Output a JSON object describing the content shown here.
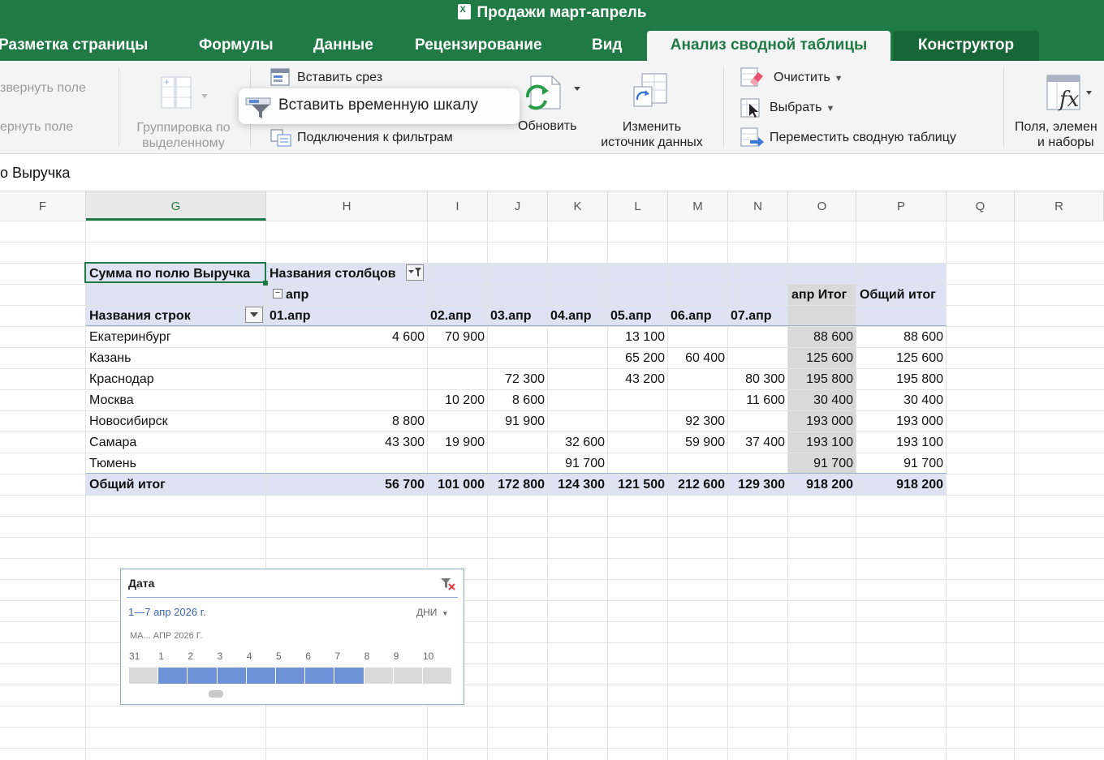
{
  "window": {
    "title": "Продажи март-апрель"
  },
  "tabs": [
    {
      "label": "Разметка страницы"
    },
    {
      "label": "Формулы"
    },
    {
      "label": "Данные"
    },
    {
      "label": "Рецензирование"
    },
    {
      "label": "Вид"
    },
    {
      "label": "Анализ сводной таблицы"
    },
    {
      "label": "Конструктор"
    }
  ],
  "ribbon": {
    "expand_field": "звернуть поле",
    "collapse_field": "ернуть поле",
    "group_line1": "Группировка по",
    "group_line2": "выделенному",
    "insert_slicer": "Вставить срез",
    "insert_timeline": "Вставить временную шкалу",
    "filter_connections": "Подключения к фильтрам",
    "refresh": "Обновить",
    "change_source_line1": "Изменить",
    "change_source_line2": "источник данных",
    "clear": "Очистить",
    "select": "Выбрать",
    "move_pivot": "Переместить сводную таблицу",
    "fields_line1": "Поля, элемен",
    "fields_line2": "и наборы",
    "accent_color": "#1f7a45"
  },
  "formula_bar": {
    "content": "о Выручка"
  },
  "columns": [
    {
      "letter": "F"
    },
    {
      "letter": "G"
    },
    {
      "letter": "H"
    },
    {
      "letter": "I"
    },
    {
      "letter": "J"
    },
    {
      "letter": "K"
    },
    {
      "letter": "L"
    },
    {
      "letter": "M"
    },
    {
      "letter": "N"
    },
    {
      "letter": "O"
    },
    {
      "letter": "P"
    },
    {
      "letter": "Q"
    },
    {
      "letter": "R"
    }
  ],
  "pivot": {
    "value_field": "Сумма по полю Выручка",
    "column_labels": "Названия столбцов",
    "month": "апр",
    "row_labels": "Названия строк",
    "date_headers": [
      "01.апр",
      "02.апр",
      "03.апр",
      "04.апр",
      "05.апр",
      "06.апр",
      "07.апр"
    ],
    "month_total_header": "апр Итог",
    "grand_total_header": "Общий итог",
    "rows": [
      {
        "city": "Екатеринбург",
        "values": [
          "4 600",
          "70 900",
          "",
          "",
          "13 100",
          "",
          ""
        ],
        "month_total": "88 600",
        "grand_total": "88 600"
      },
      {
        "city": "Казань",
        "values": [
          "",
          "",
          "",
          "",
          "65 200",
          "60 400",
          ""
        ],
        "month_total": "125 600",
        "grand_total": "125 600"
      },
      {
        "city": "Краснодар",
        "values": [
          "",
          "",
          "72 300",
          "",
          "43 200",
          "",
          "80 300"
        ],
        "month_total": "195 800",
        "grand_total": "195 800"
      },
      {
        "city": "Москва",
        "values": [
          "",
          "10 200",
          "8 600",
          "",
          "",
          "",
          "11 600"
        ],
        "month_total": "30 400",
        "grand_total": "30 400"
      },
      {
        "city": "Новосибирск",
        "values": [
          "8 800",
          "",
          "91 900",
          "",
          "",
          "92 300",
          ""
        ],
        "month_total": "193 000",
        "grand_total": "193 000"
      },
      {
        "city": "Самара",
        "values": [
          "43 300",
          "19 900",
          "",
          "32 600",
          "",
          "59 900",
          "37 400"
        ],
        "month_total": "193 100",
        "grand_total": "193 100"
      },
      {
        "city": "Тюмень",
        "values": [
          "",
          "",
          "",
          "91 700",
          "",
          "",
          ""
        ],
        "month_total": "91 700",
        "grand_total": "91 700"
      }
    ],
    "total": {
      "label": "Общий итог",
      "values": [
        "56 700",
        "101 000",
        "172 800",
        "124 300",
        "121 500",
        "212 600",
        "129 300"
      ],
      "month_total": "918 200",
      "grand_total": "918 200"
    }
  },
  "timeline": {
    "title": "Дата",
    "range": "1—7 апр 2026 г.",
    "level": "ДНИ",
    "period_label": "МА... АПР 2026 Г.",
    "ticks": [
      "31",
      "1",
      "2",
      "3",
      "4",
      "5",
      "6",
      "7",
      "8",
      "9",
      "10"
    ],
    "selected_from": "1",
    "selected_to": "7",
    "selection_color": "#6e92d8"
  }
}
